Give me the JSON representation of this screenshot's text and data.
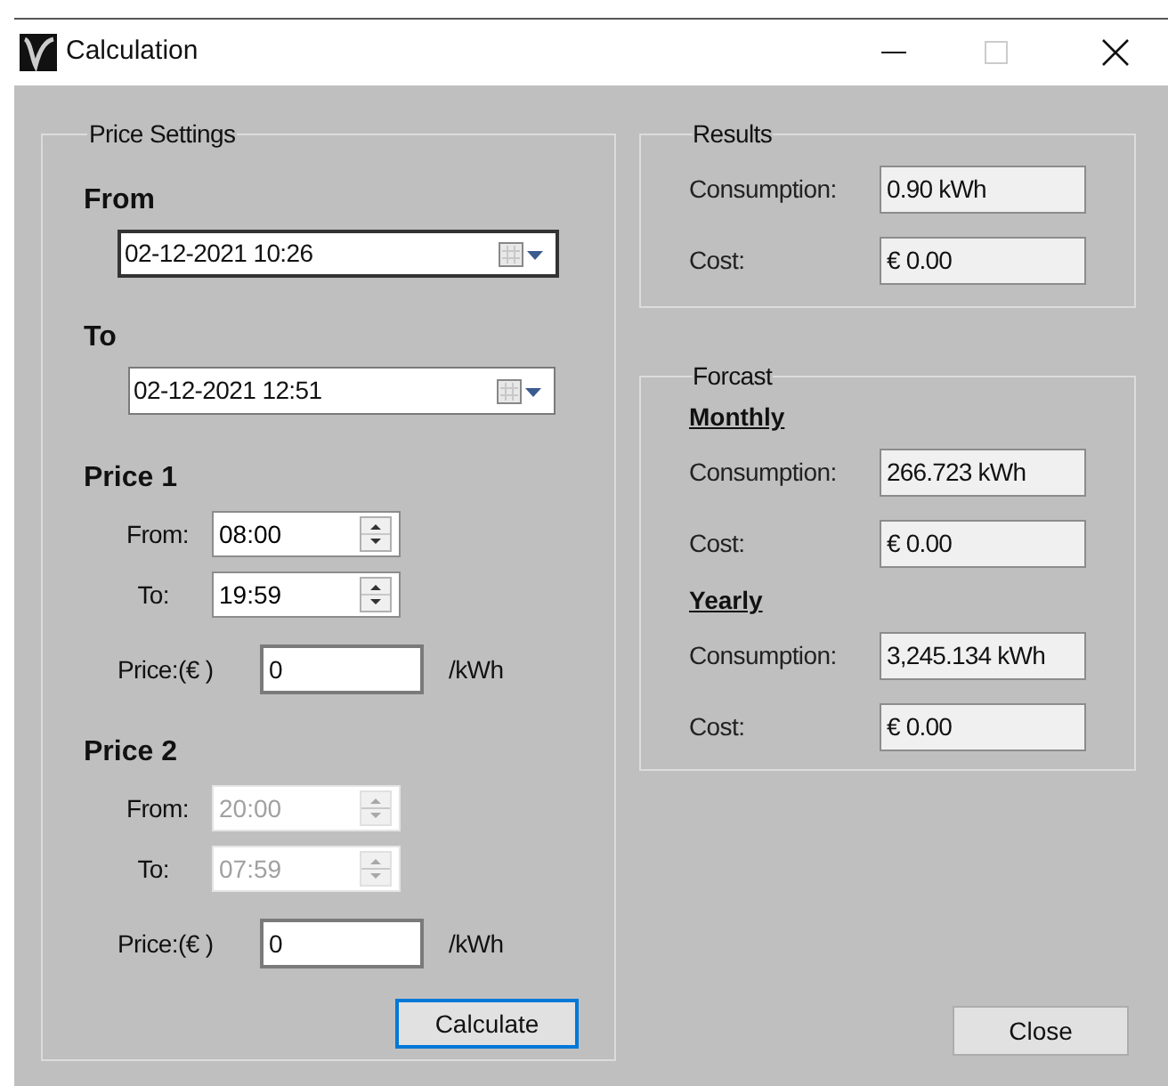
{
  "window": {
    "title": "Calculation"
  },
  "price_settings": {
    "title": "Price Settings",
    "range": [
      {
        "label": "From",
        "value": "02-12-2021 10:26",
        "focused": true
      },
      {
        "label": "To",
        "value": "02-12-2021 12:51",
        "focused": false
      }
    ],
    "prices": [
      {
        "title": "Price 1",
        "disabled": false,
        "from_label": "From:",
        "from_value": "08:00",
        "to_label": "To:",
        "to_value": "19:59",
        "price_label": "Price:(€ )",
        "price_value": "0",
        "unit": "/kWh"
      },
      {
        "title": "Price 2",
        "disabled": true,
        "from_label": "From:",
        "from_value": "20:00",
        "to_label": "To:",
        "to_value": "07:59",
        "price_label": "Price:(€ )",
        "price_value": "0",
        "unit": "/kWh"
      }
    ],
    "calculate_button": "Calculate"
  },
  "results": {
    "title": "Results",
    "rows": [
      {
        "label": "Consumption:",
        "value": "0.90 kWh"
      },
      {
        "label": "Cost:",
        "value": "€  0.00"
      }
    ]
  },
  "forecast": {
    "title": "Forcast",
    "sections": [
      {
        "title": "Monthly",
        "rows": [
          {
            "label": "Consumption:",
            "value": "266.723 kWh"
          },
          {
            "label": "Cost:",
            "value": "€  0.00"
          }
        ]
      },
      {
        "title": "Yearly",
        "rows": [
          {
            "label": "Consumption:",
            "value": "3,245.134 kWh"
          },
          {
            "label": "Cost:",
            "value": "€  0.00"
          }
        ]
      }
    ]
  },
  "close_button": "Close"
}
